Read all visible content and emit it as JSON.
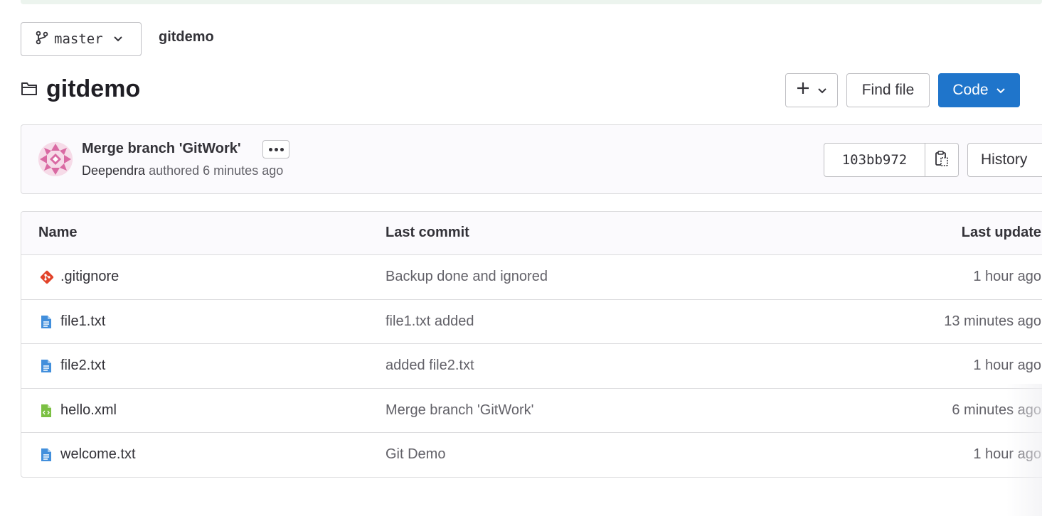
{
  "branch": {
    "name": "master",
    "icon": "branch-icon"
  },
  "breadcrumb": {
    "project": "gitdemo"
  },
  "header": {
    "title": "gitdemo",
    "add_icon": "plus-icon",
    "find_file_label": "Find file",
    "code_label": "Code"
  },
  "last_commit": {
    "title": "Merge branch 'GitWork'",
    "author": "Deependra",
    "authored_text": "authored 6 minutes ago",
    "sha": "103bb972",
    "history_label": "History"
  },
  "table": {
    "columns": {
      "name": "Name",
      "last_commit": "Last commit",
      "last_update": "Last update"
    },
    "rows": [
      {
        "name": ".gitignore",
        "icon": "git-icon",
        "commit": "Backup done and ignored",
        "updated": "1 hour ago"
      },
      {
        "name": "file1.txt",
        "icon": "text-file-icon",
        "commit": "file1.txt added",
        "updated": "13 minutes ago"
      },
      {
        "name": "file2.txt",
        "icon": "text-file-icon",
        "commit": "added file2.txt",
        "updated": "1 hour ago"
      },
      {
        "name": "hello.xml",
        "icon": "xml-file-icon",
        "commit": "Merge branch 'GitWork'",
        "updated": "6 minutes ago"
      },
      {
        "name": "welcome.txt",
        "icon": "text-file-icon",
        "commit": "Git Demo",
        "updated": "1 hour ago"
      }
    ]
  },
  "colors": {
    "primary": "#1f75cb",
    "text": "#333238",
    "muted": "#626168",
    "border": "#dcdcde",
    "git_icon": "#e24329",
    "text_file_icon": "#428fdc",
    "xml_file_icon": "#7bc043"
  }
}
